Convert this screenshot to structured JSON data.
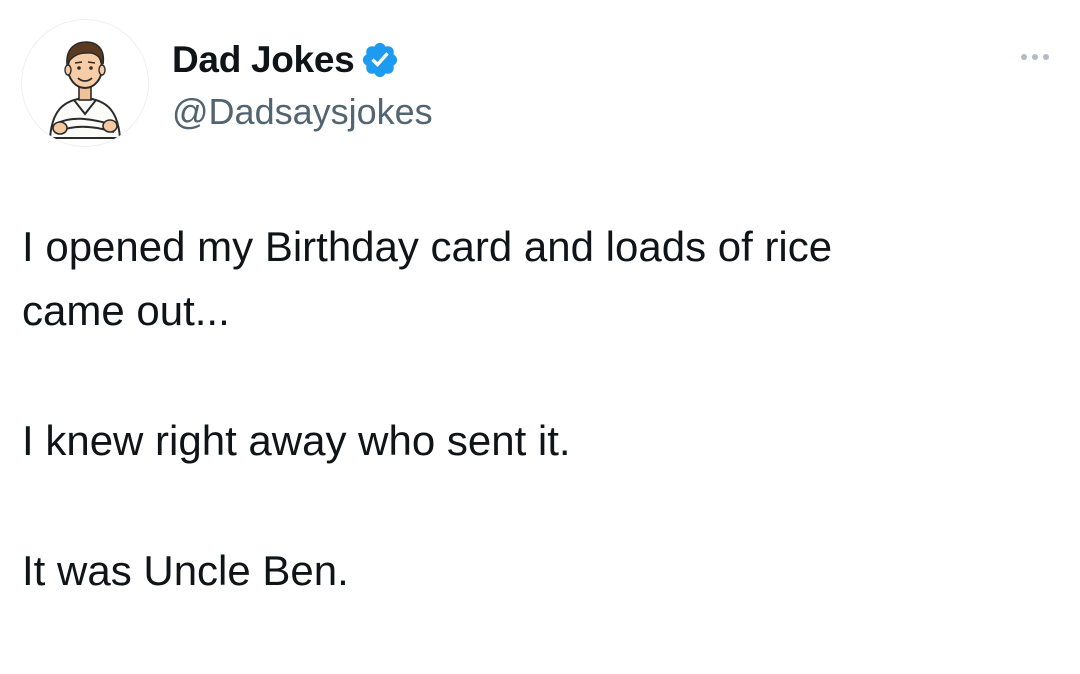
{
  "author": {
    "display_name": "Dad Jokes",
    "handle": "@Dadsaysjokes",
    "verified_icon": "verified-badge-icon",
    "verified_color": "#1d9bf0",
    "avatar": "cartoon-dad-avatar"
  },
  "menu": {
    "icon": "more-options-icon"
  },
  "tweet": {
    "line_1": "I opened my Birthday card and loads of rice",
    "line_2": "came out...",
    "line_3": "I knew right away who sent it.",
    "line_4": "It was Uncle Ben."
  },
  "colors": {
    "text": "#0f1419",
    "secondary_text": "#536471",
    "background": "#ffffff"
  }
}
